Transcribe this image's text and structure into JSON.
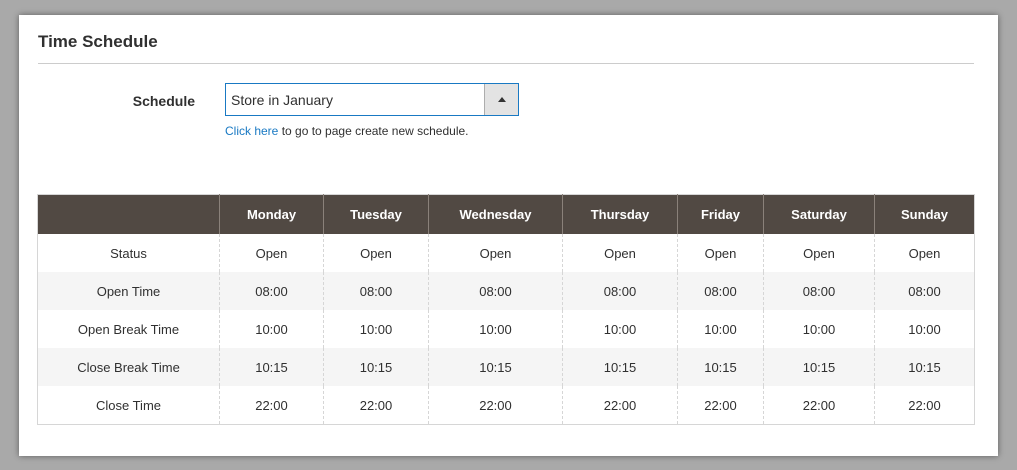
{
  "section": {
    "title": "Time Schedule"
  },
  "schedule_field": {
    "label": "Schedule",
    "selected": "Store in January",
    "hint_link": "Click here",
    "hint_text": " to go to page create new schedule."
  },
  "table": {
    "headers": [
      "",
      "Monday",
      "Tuesday",
      "Wednesday",
      "Thursday",
      "Friday",
      "Saturday",
      "Sunday"
    ],
    "rows": [
      {
        "label": "Status",
        "values": [
          "Open",
          "Open",
          "Open",
          "Open",
          "Open",
          "Open",
          "Open"
        ]
      },
      {
        "label": "Open Time",
        "values": [
          "08:00",
          "08:00",
          "08:00",
          "08:00",
          "08:00",
          "08:00",
          "08:00"
        ]
      },
      {
        "label": "Open Break Time",
        "values": [
          "10:00",
          "10:00",
          "10:00",
          "10:00",
          "10:00",
          "10:00",
          "10:00"
        ]
      },
      {
        "label": "Close Break Time",
        "values": [
          "10:15",
          "10:15",
          "10:15",
          "10:15",
          "10:15",
          "10:15",
          "10:15"
        ]
      },
      {
        "label": "Close Time",
        "values": [
          "22:00",
          "22:00",
          "22:00",
          "22:00",
          "22:00",
          "22:00",
          "22:00"
        ]
      }
    ]
  },
  "colors": {
    "header_bg": "#514943",
    "link": "#1979c3",
    "select_border": "#1979c3"
  },
  "icons": {
    "select_toggle": "arrow-up-icon"
  }
}
